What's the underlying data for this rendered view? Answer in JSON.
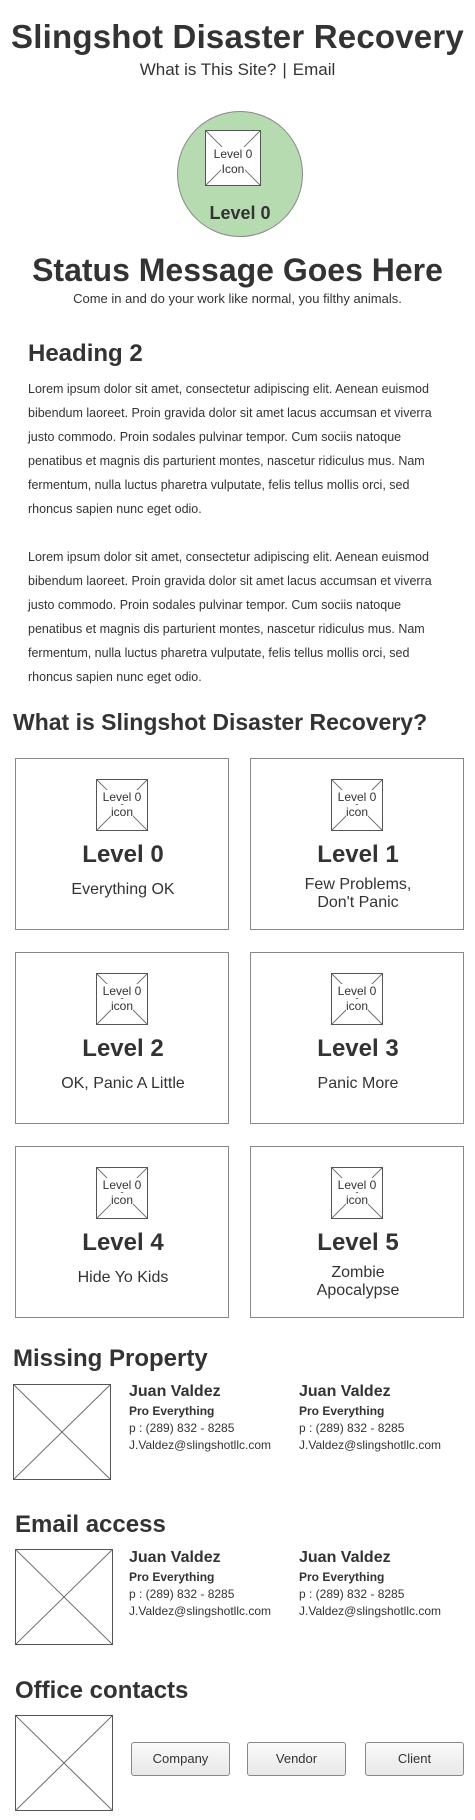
{
  "header": {
    "title": "Slingshot Disaster Recovery",
    "nav": {
      "about": "What is This Site?",
      "separator": "|",
      "email": "Email"
    }
  },
  "status": {
    "badge_icon_line1": "Level 0",
    "badge_icon_line2": "Icon",
    "badge_label": "Level 0",
    "badge_color": "#b6dbb0",
    "message": "Status Message Goes Here",
    "submessage": "Come in and do your work like normal, you filthy animals."
  },
  "content": {
    "heading": "Heading 2",
    "paragraphs": [
      "Lorem ipsum dolor sit amet, consectetur adipiscing elit. Aenean euismod bibendum laoreet. Proin gravida dolor sit amet lacus accumsan et viverra justo commodo. Proin sodales pulvinar tempor. Cum sociis natoque penatibus et magnis dis parturient montes, nascetur ridiculus mus. Nam fermentum, nulla luctus pharetra vulputate, felis tellus mollis orci, sed rhoncus sapien nunc eget odio.",
      "Lorem ipsum dolor sit amet, consectetur adipiscing elit. Aenean euismod bibendum laoreet. Proin gravida dolor sit amet lacus accumsan et viverra justo commodo. Proin sodales pulvinar tempor. Cum sociis natoque penatibus et magnis dis parturient montes, nascetur ridiculus mus. Nam fermentum, nulla luctus pharetra vulputate, felis tellus mollis orci, sed rhoncus sapien nunc eget odio."
    ]
  },
  "levels": {
    "heading": "What is Slingshot Disaster Recovery?",
    "cards": [
      {
        "icon_line1": "Level 0",
        "icon_line2": "icon",
        "title": "Level 0",
        "desc_line1": "Everything OK",
        "desc_line2": ""
      },
      {
        "icon_line1": "Level 0",
        "icon_line2": "icon",
        "title": "Level 1",
        "desc_line1": "Few Problems,",
        "desc_line2": "Don't Panic"
      },
      {
        "icon_line1": "Level 0",
        "icon_line2": "icon",
        "title": "Level 2",
        "desc_line1": "OK, Panic A Little",
        "desc_line2": ""
      },
      {
        "icon_line1": "Level 0",
        "icon_line2": "icon",
        "title": "Level 3",
        "desc_line1": "Panic More",
        "desc_line2": ""
      },
      {
        "icon_line1": "Level 0",
        "icon_line2": "icon",
        "title": "Level 4",
        "desc_line1": "Hide Yo Kids",
        "desc_line2": ""
      },
      {
        "icon_line1": "Level 0",
        "icon_line2": "icon",
        "title": "Level 5",
        "desc_line1": "Zombie",
        "desc_line2": "Apocalypse"
      }
    ]
  },
  "missing_property": {
    "heading": "Missing Property",
    "contacts": [
      {
        "name": "Juan Valdez",
        "role": "Pro Everything",
        "phone": "p : (289) 832 - 8285",
        "email": "J.Valdez@slingshotllc.com"
      },
      {
        "name": "Juan Valdez",
        "role": "Pro Everything",
        "phone": "p : (289) 832 - 8285",
        "email": "J.Valdez@slingshotllc.com"
      }
    ]
  },
  "email_access": {
    "heading": "Email access",
    "contacts": [
      {
        "name": "Juan Valdez",
        "role": "Pro Everything",
        "phone": "p : (289) 832 - 8285",
        "email": "J.Valdez@slingshotllc.com"
      },
      {
        "name": "Juan Valdez",
        "role": "Pro Everything",
        "phone": "p : (289) 832 - 8285",
        "email": "J.Valdez@slingshotllc.com"
      }
    ]
  },
  "office_contacts": {
    "heading": "Office contacts",
    "buttons": {
      "company": "Company",
      "vendor": "Vendor",
      "client": "Client"
    }
  }
}
